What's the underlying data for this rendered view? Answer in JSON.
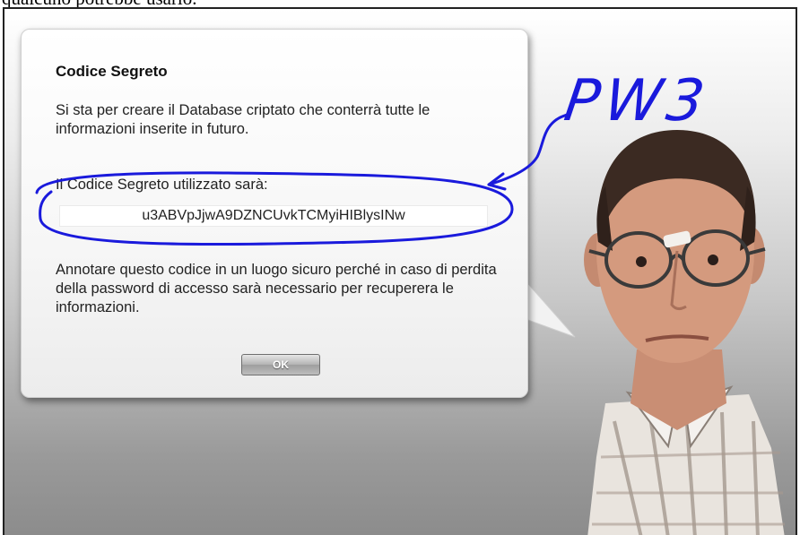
{
  "caption": "qualcuno potrebbe usarlo.",
  "dialog": {
    "title": "Codice Segreto",
    "intro": "Si sta per creare il Database criptato che conterrà tutte le informazioni inserite in futuro.",
    "code_label": "Il Codice Segreto utilizzato sarà:",
    "code_value": "u3ABVpJjwA9DZNCUvkTCMyiHIBlysINw",
    "notice": "Annotare questo codice in un luogo sicuro perché in caso di perdita della password di accesso sarà necessario per recuperera le informazioni.",
    "ok_label": "OK"
  },
  "annotation": {
    "text": "PW3",
    "color": "#1a1adc"
  },
  "colors": {
    "background_top": "#ffffff",
    "background_bottom": "#8c8c8c",
    "dialog": "#f6f6f6"
  }
}
